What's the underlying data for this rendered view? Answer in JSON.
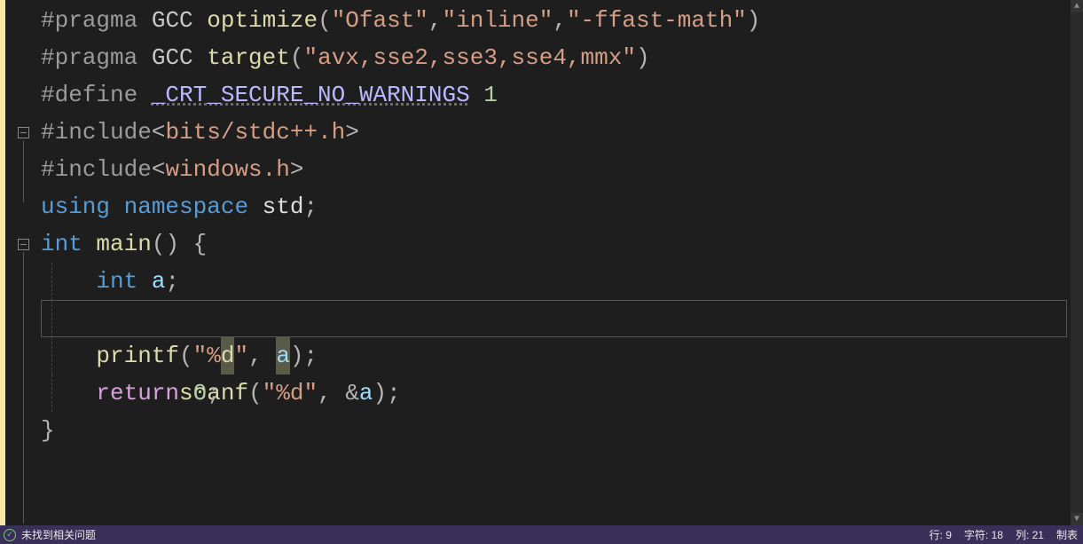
{
  "code": {
    "line1": {
      "hash": "#",
      "dir": "pragma",
      "gcc": " GCC ",
      "fn": "optimize",
      "open": "(",
      "s1": "\"Ofast\"",
      "c1": ",",
      "s2": "\"inline\"",
      "c2": ",",
      "s3": "\"-ffast-math\"",
      "close": ")"
    },
    "line2": {
      "hash": "#",
      "dir": "pragma",
      "gcc": " GCC ",
      "fn": "target",
      "open": "(",
      "s1": "\"avx,sse2,sse3,sse4,mmx\"",
      "close": ")"
    },
    "line3": {
      "hash": "#",
      "dir": "define ",
      "macro": "_CRT_SECURE_NO_WARNINGS",
      "sp": " ",
      "val": "1"
    },
    "line4": {
      "hash": "#",
      "dir": "include",
      "lt": "<",
      "hdr": "bits/stdc++.h",
      "gt": ">"
    },
    "line5": {
      "hash": "#",
      "dir": "include",
      "lt": "<",
      "hdr": "windows.h",
      "gt": ">"
    },
    "line6": {
      "using": "using",
      "sp": " ",
      "ns": "namespace",
      "sp2": " ",
      "std": "std",
      "semi": ";"
    },
    "line7": {
      "int": "int",
      "sp": " ",
      "main": "main",
      "paren": "()",
      "sp2": " ",
      "brace": "{"
    },
    "line8": {
      "indent": "    ",
      "int": "int",
      "sp": " ",
      "a": "a",
      "semi": ";"
    },
    "line9": {
      "indent": "    ",
      "fn": "scanf",
      "open": "(",
      "s": "\"%d\"",
      "c": ",",
      "sp": " ",
      "amp": "&",
      "a": "a",
      "close": ")",
      "semi": ";"
    },
    "line10": {
      "indent": "    ",
      "fn": "printf",
      "open": "(",
      "q1": "\"",
      "pct": "%",
      "d": "d",
      "q2": "\"",
      "c": ",",
      "sp": " ",
      "a": "a",
      "close": ")",
      "semi": ";"
    },
    "line11": {
      "indent": "    ",
      "ret": "return",
      "sp": " ",
      "zero": "0",
      "semi": ";"
    },
    "line12": {
      "brace": "}"
    }
  },
  "status": {
    "issues": "未找到相关问题",
    "line_lbl": "行:",
    "line_val": "9",
    "char_lbl": "字符:",
    "char_val": "18",
    "col_lbl": "列:",
    "col_val": "21",
    "tab": "制表"
  }
}
